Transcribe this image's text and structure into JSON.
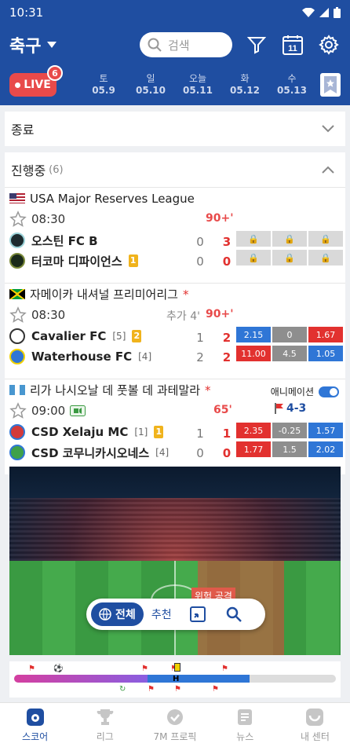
{
  "status": {
    "time": "10:31"
  },
  "header": {
    "title": "축구",
    "search_placeholder": "검색",
    "calendar_day": "11"
  },
  "datebar": {
    "live_label": "LIVE",
    "live_count": "6",
    "dates": [
      {
        "day": "토",
        "date": "05.9"
      },
      {
        "day": "일",
        "date": "05.10"
      },
      {
        "day": "오늘",
        "date": "05.11"
      },
      {
        "day": "화",
        "date": "05.12"
      },
      {
        "day": "수",
        "date": "05.13"
      }
    ]
  },
  "sections": {
    "finished": "종료",
    "ongoing": "진행중",
    "ongoing_count": "(6)"
  },
  "matches": [
    {
      "league": "USA Major Reserves League",
      "time": "08:30",
      "minute": "90+'",
      "home": {
        "name": "오스틴 FC B",
        "rank": "",
        "card": ""
      },
      "away": {
        "name": "터코마 디파이언스",
        "rank": "",
        "card": "1"
      },
      "home_half": "0",
      "home_score": "3",
      "away_half": "0",
      "away_score": "0"
    },
    {
      "league": "자메이카 내셔널 프리미어리그",
      "league_mark": "*",
      "time": "08:30",
      "extra": "추가 4'",
      "minute": "90+'",
      "home": {
        "name": "Cavalier FC",
        "rank": "[5]",
        "card": "2"
      },
      "away": {
        "name": "Waterhouse FC",
        "rank": "[4]",
        "card": ""
      },
      "home_half": "1",
      "home_score": "2",
      "away_half": "2",
      "away_score": "2",
      "odds_home": [
        "2.15",
        "0",
        "1.67"
      ],
      "odds_away": [
        "11.00",
        "4.5",
        "1.05"
      ]
    },
    {
      "league": "리가 나시오날 데 풋볼 데 과테말라",
      "league_mark": "*",
      "animation_label": "애니메이션",
      "time": "09:00",
      "minute": "65'",
      "corners": "4-3",
      "home": {
        "name": "CSD Xelaju MC",
        "rank": "[1]",
        "card": "1"
      },
      "away": {
        "name": "CSD 코무니카시오네스",
        "rank": "[4]",
        "card": ""
      },
      "home_half": "1",
      "home_score": "1",
      "away_half": "0",
      "away_score": "0",
      "odds_home": [
        "2.35",
        "-0.25",
        "1.57"
      ],
      "odds_away": [
        "1.77",
        "1.5",
        "2.02"
      ]
    }
  ],
  "pitch": {
    "attack_label": "위험 공격",
    "all_label": "전체",
    "recommend_label": "추천",
    "half_marker": "H"
  },
  "tabs": [
    {
      "label": "스코어"
    },
    {
      "label": "리그"
    },
    {
      "label": "7M 프로픽"
    },
    {
      "label": "뉴스"
    },
    {
      "label": "내 센터"
    }
  ],
  "colors": {
    "brand": "#1f4ea1",
    "live": "#e84a4a",
    "odd_up": "#e2312f",
    "odd_down": "#2f76d6"
  }
}
